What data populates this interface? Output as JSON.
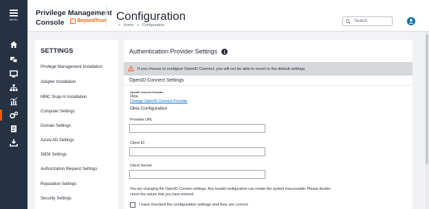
{
  "app": {
    "menu_label": "MENU",
    "brand_line1": "Privilege Management",
    "brand_line2": "Console",
    "logo_text": "BeyondTrust"
  },
  "header": {
    "title": "Configuration",
    "breadcrumb": [
      "Home",
      ">",
      "Configuration"
    ],
    "breadcrumb_prefix": ">",
    "search_placeholder": "Search"
  },
  "rail_icons": [
    "home-icon",
    "groups-icon",
    "computer-icon",
    "hierarchy-icon",
    "analytics-icon",
    "configuration-icon",
    "policy-icon",
    "download-icon"
  ],
  "settings": {
    "title": "SETTINGS",
    "items": [
      "Privilege Management Installation",
      "Adapter Installation",
      "MMC Snap-In Installation",
      "Computer Settings",
      "Domain Settings",
      "Azure AD Settings",
      "SIEM Settings",
      "Authorization Request Settings",
      "Reputation Settings",
      "Security Settings"
    ]
  },
  "main": {
    "title": "Authentication Provider Settings",
    "warning": "If you choose to configure OpenID Connect, you will not be able to revert to the default settings.",
    "section_title": "OpenID Connect Settings",
    "provider_label": "OpenID Connect Provider",
    "provider_value": "Okta",
    "change_link": "Change OpenID Connect Provider",
    "okta_heading": "Okta Configuration",
    "fields": [
      {
        "label": "Provider URL",
        "value": ""
      },
      {
        "label": "Client ID",
        "value": ""
      },
      {
        "label": "Client Secret",
        "value": ""
      }
    ],
    "note": "You are changing the OpenID Connect settings. Any invalid configuration can render the system inaccessible. Please double-check the values that you have entered.",
    "confirm_label": "I have checked the configuration settings and they are correct.",
    "confirm_checked": false
  },
  "colors": {
    "rail": "#263244",
    "accent": "#ff5500",
    "link": "#0a68c4",
    "user_icon": "#0d6fb8"
  }
}
